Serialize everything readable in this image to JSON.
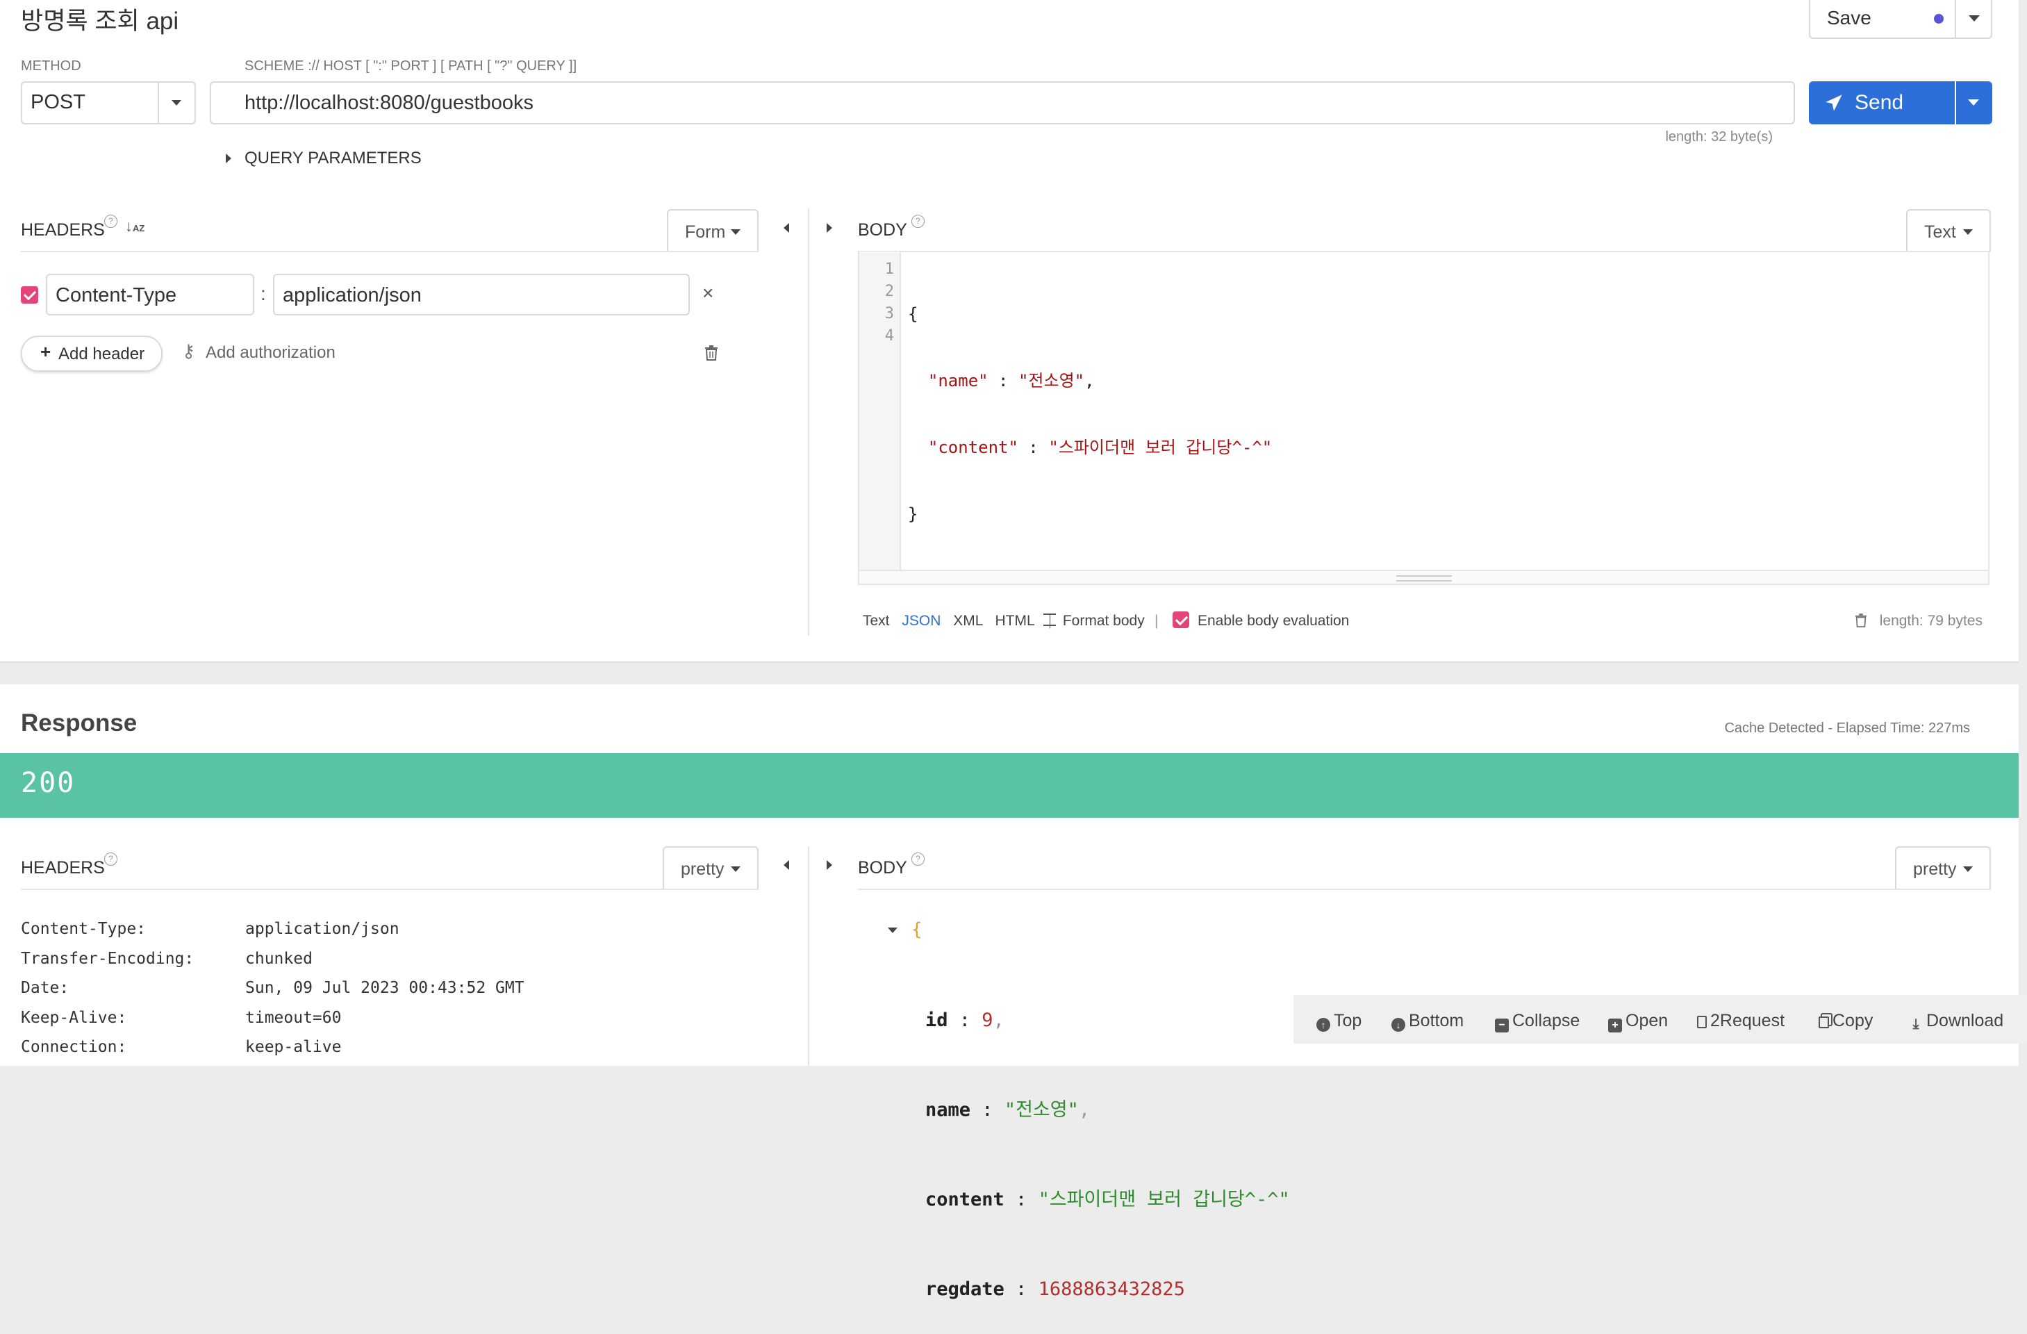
{
  "request": {
    "title": "방명록 조회 api",
    "save_label": "Save",
    "method_label": "METHOD",
    "method_value": "POST",
    "url_label": "SCHEME :// HOST [ \":\" PORT ] [ PATH [ \"?\" QUERY ]]",
    "url_value": "http://localhost:8080/guestbooks",
    "url_length": "length: 32 byte(s)",
    "send_label": "Send",
    "query_params_label": "QUERY PARAMETERS",
    "headers": {
      "label": "HEADERS",
      "mode": "Form",
      "items": [
        {
          "name": "Content-Type",
          "separator": ":",
          "value": "application/json"
        }
      ],
      "add_header": "Add header",
      "add_authorization": "Add authorization"
    },
    "body": {
      "label": "BODY",
      "mode": "Text",
      "line_numbers": [
        "1",
        "2",
        "3",
        "4"
      ],
      "code": {
        "open": "{",
        "name_key": "\"name\"",
        "name_sep": " : ",
        "name_val": "\"전소영\"",
        "comma": ",",
        "content_key": "\"content\"",
        "content_sep": " : ",
        "content_val": "\"스파이더맨 보러 갑니당^-^\"",
        "close": "}"
      },
      "formats": [
        "Text",
        "JSON",
        "XML",
        "HTML"
      ],
      "active_format": "JSON",
      "divider": "|",
      "format_body": "Format body",
      "enable_eval": "Enable body evaluation",
      "length": "length: 79 bytes"
    }
  },
  "response": {
    "title": "Response",
    "meta": "Cache Detected - Elapsed Time: 227ms",
    "status_code": "200",
    "headers_label": "HEADERS",
    "headers_mode": "pretty",
    "headers": [
      {
        "name": "Content-Type:",
        "value": "application/json"
      },
      {
        "name": "Transfer-Encoding:",
        "value": "chunked"
      },
      {
        "name": "Date:",
        "value": "Sun, 09 Jul 2023 00:43:52 GMT"
      },
      {
        "name": "Keep-Alive:",
        "value": "timeout=60"
      },
      {
        "name": "Connection:",
        "value": "keep-alive"
      }
    ],
    "body_label": "BODY",
    "body_mode": "pretty",
    "json": {
      "open": "{",
      "id_key": "id",
      "id_val": "9",
      "name_key": "name",
      "name_val": "\"전소영\"",
      "content_key": "content",
      "content_val": "\"스파이더맨 보러 갑니당^-^\"",
      "regdate_key": "regdate",
      "regdate_val": "1688863432825",
      "colon": " : ",
      "comma": ","
    },
    "toolbar": [
      "Top",
      "Bottom",
      "Collapse",
      "Open",
      "2Request",
      "Copy",
      "Download"
    ]
  },
  "colors": {
    "accent_blue": "#2d6fd8",
    "status_green": "#5ac2a5",
    "checkbox_pink": "#e2457a",
    "json_string": "#2e8b2e",
    "json_number": "#b03030",
    "code_string": "#a31515"
  }
}
